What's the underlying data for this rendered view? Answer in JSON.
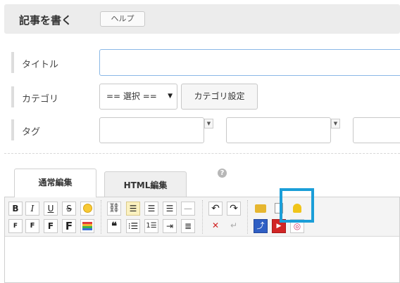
{
  "header": {
    "title": "記事を書く",
    "help_label": "ヘルプ"
  },
  "form": {
    "title_label": "タイトル",
    "title_value": "",
    "category_label": "カテゴリ",
    "category_select": "== 選択 ==",
    "category_settings_button": "カテゴリ設定",
    "tag_label": "タグ"
  },
  "tabs": {
    "normal": "通常編集",
    "html": "HTML編集",
    "help": "?"
  },
  "toolbar": {
    "row1": {
      "bold": "B",
      "italic": "I",
      "underline": "U",
      "strike": "S",
      "emoji_icon": "smile-icon",
      "link_icon": "link-icon",
      "align_left_icon": "align-left-icon",
      "align_center_icon": "align-center-icon",
      "align_right_icon": "align-right-icon",
      "hr_icon": "horizontal-rule-icon",
      "undo_icon": "undo-icon",
      "redo_icon": "redo-icon",
      "folder_icon": "folder-icon",
      "clipboard_icon": "clipboard-icon",
      "bell_icon": "bell-icon"
    },
    "row2": {
      "font_xs": "F",
      "font_s": "F",
      "font_m": "F",
      "font_l": "F",
      "color_icon": "color-bars-icon",
      "quote": "66",
      "bullet_list_icon": "bullet-list-icon",
      "numbered_list_icon": "numbered-list-icon",
      "indent_icon": "indent-icon",
      "more_icon": "more-icon",
      "clear_icon": "clear-format-icon",
      "enter_icon": "enter-icon",
      "amazon_icon": "amazon-icon",
      "youtube_icon": "youtube-icon",
      "instagram_icon": "instagram-icon"
    }
  },
  "colors": {
    "accent": "#1b9ed8",
    "highlight": "#fbf1bf"
  }
}
